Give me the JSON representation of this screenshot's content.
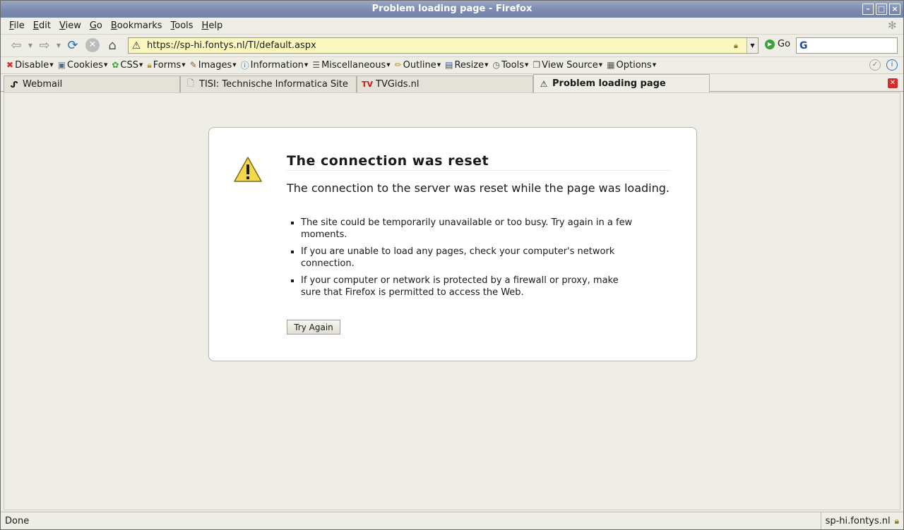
{
  "window": {
    "title": "Problem loading page - Firefox"
  },
  "menu": [
    {
      "label": "File",
      "key": "F",
      "rest": "ile"
    },
    {
      "label": "Edit",
      "key": "E",
      "rest": "dit"
    },
    {
      "label": "View",
      "key": "V",
      "rest": "iew"
    },
    {
      "label": "Go",
      "key": "G",
      "rest": "o"
    },
    {
      "label": "Bookmarks",
      "key": "B",
      "rest": "ookmarks"
    },
    {
      "label": "Tools",
      "key": "T",
      "rest": "ools"
    },
    {
      "label": "Help",
      "key": "H",
      "rest": "elp"
    }
  ],
  "navbar": {
    "url": "https://sp-hi.fontys.nl/TI/default.aspx",
    "go_label": "Go",
    "search_value": ""
  },
  "devbar": {
    "items": [
      "Disable",
      "Cookies",
      "CSS",
      "Forms",
      "Images",
      "Information",
      "Miscellaneous",
      "Outline",
      "Resize",
      "Tools",
      "View Source",
      "Options"
    ]
  },
  "tabs": [
    {
      "label": "Webmail",
      "icon": "fontys-icon"
    },
    {
      "label": "TISI: Technische Informatica Site",
      "icon": "page-icon"
    },
    {
      "label": "TVGids.nl",
      "icon": "tv-icon"
    },
    {
      "label": "Problem loading page",
      "icon": "warning-icon"
    }
  ],
  "error": {
    "title": "The connection was reset",
    "description": "The connection to the server was reset while the page was loading.",
    "bullets": [
      "The site could be temporarily unavailable or too busy. Try again in a few moments.",
      "If you are unable to load any pages, check your computer's network connection.",
      "If your computer or network is protected by a firewall or proxy, make sure that Firefox is permitted to access the Web."
    ],
    "button": "Try Again"
  },
  "status": {
    "left": "Done",
    "right": "sp-hi.fontys.nl"
  }
}
